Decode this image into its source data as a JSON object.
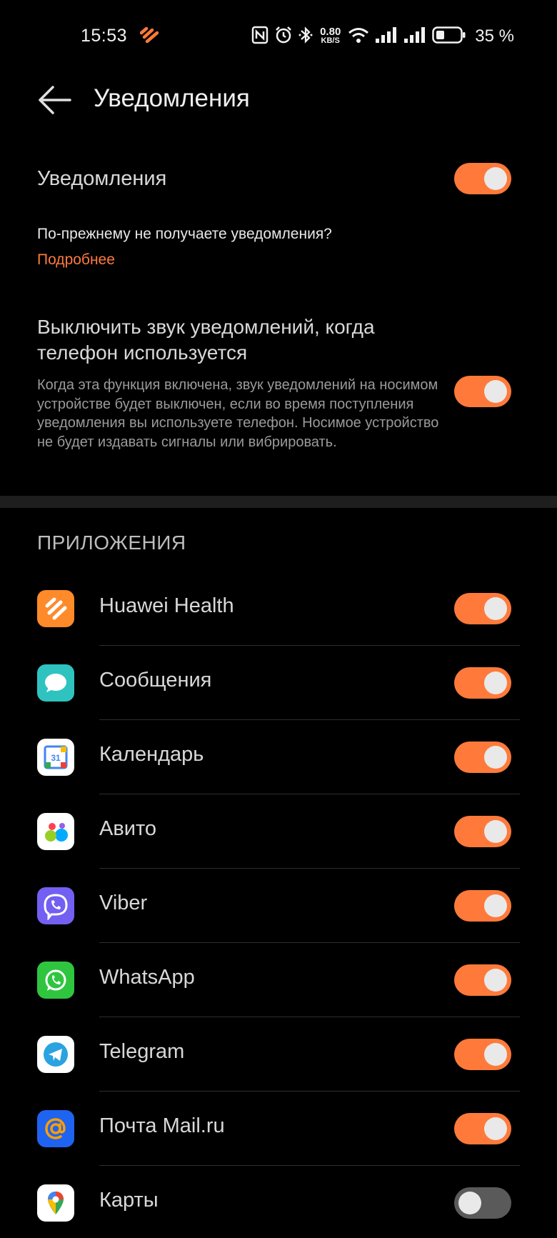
{
  "status_bar": {
    "time": "15:53",
    "net_speed_value": "0.80",
    "net_speed_unit": "KB/S",
    "battery_percent": "35 %",
    "icons": [
      "huawei-health-icon",
      "nfc-icon",
      "alarm-icon",
      "bluetooth-icon",
      "wifi-icon",
      "signal-icon",
      "signal-icon",
      "battery-icon"
    ]
  },
  "header": {
    "title": "Уведомления"
  },
  "settings": {
    "notifications_label": "Уведомления",
    "notifications_enabled": true,
    "hint_text": "По-прежнему не получаете уведомления?",
    "hint_link": "Подробнее",
    "mute_title": "Выключить звук уведомлений, когда телефон используется",
    "mute_description": "Когда эта функция включена, звук уведомлений на носимом устройстве будет выключен, если во время поступления уведомления вы используете телефон. Носимое устройство не будет издавать сигналы или вибрировать.",
    "mute_enabled": true
  },
  "apps_section": {
    "header": "ПРИЛОЖЕНИЯ",
    "items": [
      {
        "name": "Huawei Health",
        "icon": "huawei-health-icon",
        "enabled": true
      },
      {
        "name": "Сообщения",
        "icon": "messages-icon",
        "enabled": true
      },
      {
        "name": "Календарь",
        "icon": "calendar-icon",
        "enabled": true
      },
      {
        "name": "Авито",
        "icon": "avito-icon",
        "enabled": true
      },
      {
        "name": "Viber",
        "icon": "viber-icon",
        "enabled": true
      },
      {
        "name": "WhatsApp",
        "icon": "whatsapp-icon",
        "enabled": true
      },
      {
        "name": "Telegram",
        "icon": "telegram-icon",
        "enabled": true
      },
      {
        "name": "Почта Mail.ru",
        "icon": "mail-ru-icon",
        "enabled": true
      },
      {
        "name": "Карты",
        "icon": "maps-icon",
        "enabled": false
      }
    ]
  },
  "colors": {
    "accent": "#ff7a3a",
    "background": "#000000",
    "toggle_off": "#5a5a5a"
  }
}
